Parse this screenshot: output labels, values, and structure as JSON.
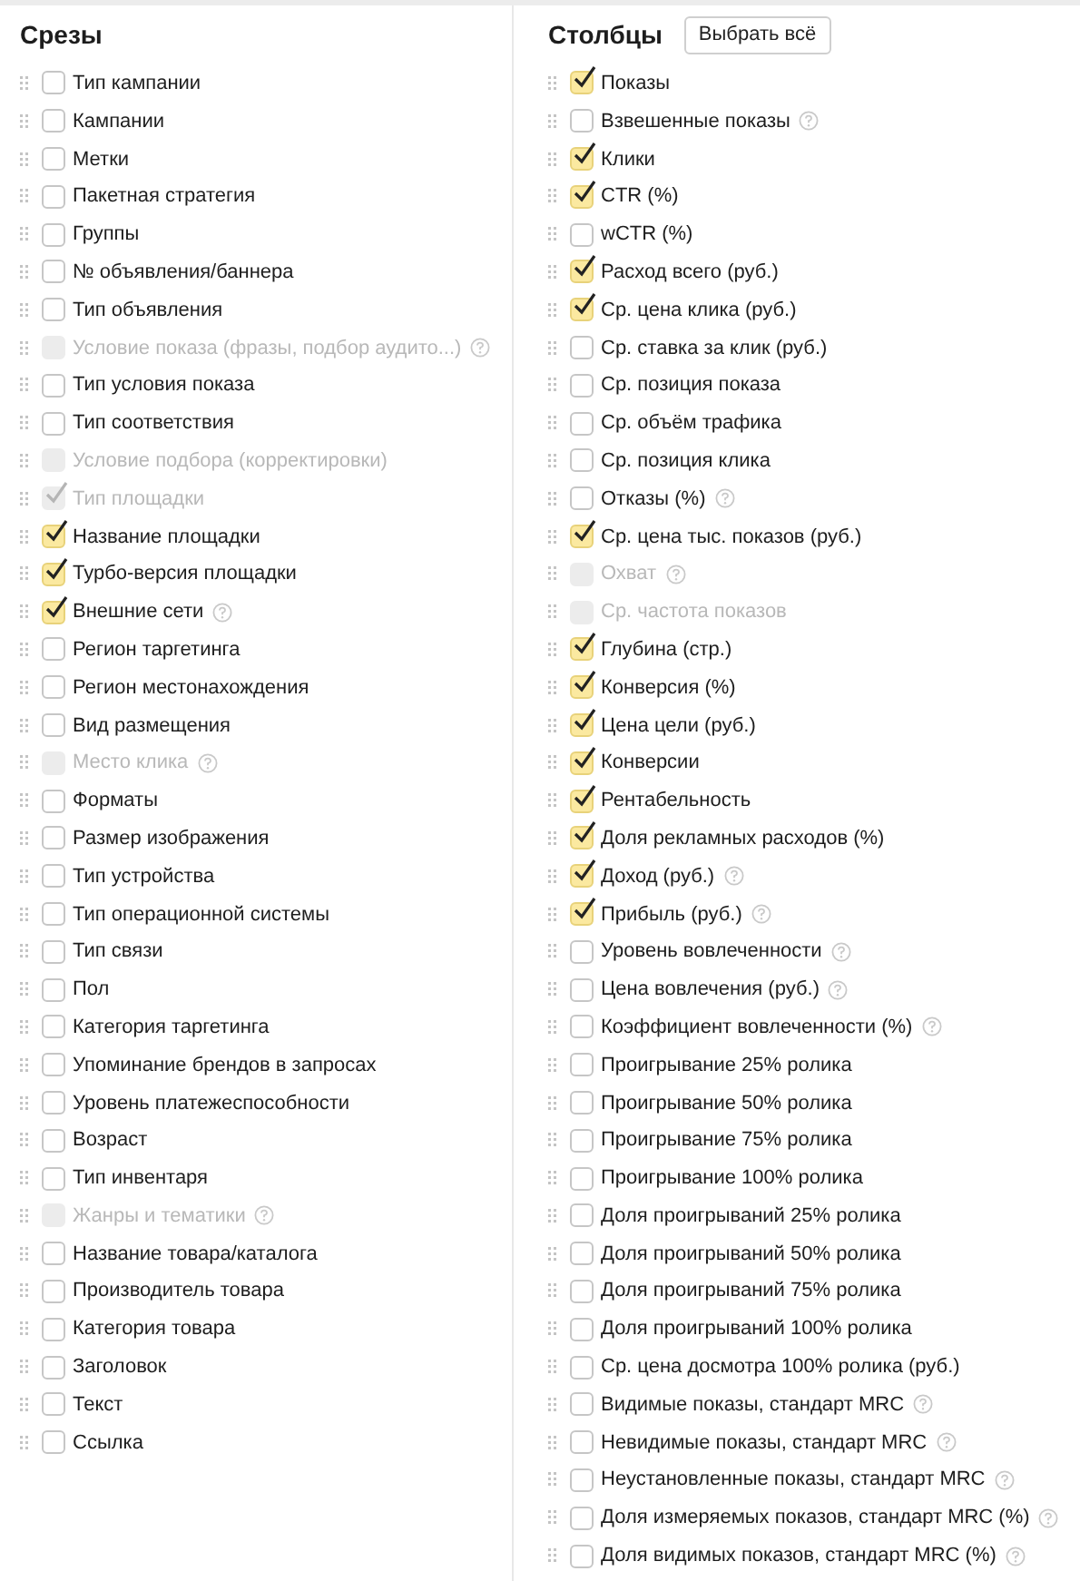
{
  "slices": {
    "title": "Срезы",
    "items": [
      {
        "label": "Тип кампании",
        "checked": false,
        "disabled": false,
        "help": false
      },
      {
        "label": "Кампании",
        "checked": false,
        "disabled": false,
        "help": false
      },
      {
        "label": "Метки",
        "checked": false,
        "disabled": false,
        "help": false
      },
      {
        "label": "Пакетная стратегия",
        "checked": false,
        "disabled": false,
        "help": false
      },
      {
        "label": "Группы",
        "checked": false,
        "disabled": false,
        "help": false
      },
      {
        "label": "№ объявления/баннера",
        "checked": false,
        "disabled": false,
        "help": false
      },
      {
        "label": "Тип объявления",
        "checked": false,
        "disabled": false,
        "help": false
      },
      {
        "label": "Условие показа (фразы, подбор аудито...)",
        "checked": false,
        "disabled": true,
        "help": true
      },
      {
        "label": "Тип условия показа",
        "checked": false,
        "disabled": false,
        "help": false
      },
      {
        "label": "Тип соответствия",
        "checked": false,
        "disabled": false,
        "help": false
      },
      {
        "label": "Условие подбора (корректировки)",
        "checked": false,
        "disabled": true,
        "help": false
      },
      {
        "label": "Тип площадки",
        "checked": true,
        "disabled": true,
        "help": false
      },
      {
        "label": "Название площадки",
        "checked": true,
        "disabled": false,
        "help": false
      },
      {
        "label": "Турбо-версия площадки",
        "checked": true,
        "disabled": false,
        "help": false
      },
      {
        "label": "Внешние сети",
        "checked": true,
        "disabled": false,
        "help": true
      },
      {
        "label": "Регион таргетинга",
        "checked": false,
        "disabled": false,
        "help": false
      },
      {
        "label": "Регион местонахождения",
        "checked": false,
        "disabled": false,
        "help": false
      },
      {
        "label": "Вид размещения",
        "checked": false,
        "disabled": false,
        "help": false
      },
      {
        "label": "Место клика",
        "checked": false,
        "disabled": true,
        "help": true
      },
      {
        "label": "Форматы",
        "checked": false,
        "disabled": false,
        "help": false
      },
      {
        "label": "Размер изображения",
        "checked": false,
        "disabled": false,
        "help": false
      },
      {
        "label": "Тип устройства",
        "checked": false,
        "disabled": false,
        "help": false
      },
      {
        "label": "Тип операционной системы",
        "checked": false,
        "disabled": false,
        "help": false
      },
      {
        "label": "Тип связи",
        "checked": false,
        "disabled": false,
        "help": false
      },
      {
        "label": "Пол",
        "checked": false,
        "disabled": false,
        "help": false
      },
      {
        "label": "Категория таргетинга",
        "checked": false,
        "disabled": false,
        "help": false
      },
      {
        "label": "Упоминание брендов в запросах",
        "checked": false,
        "disabled": false,
        "help": false
      },
      {
        "label": "Уровень платежеспособности",
        "checked": false,
        "disabled": false,
        "help": false
      },
      {
        "label": "Возраст",
        "checked": false,
        "disabled": false,
        "help": false
      },
      {
        "label": "Тип инвентаря",
        "checked": false,
        "disabled": false,
        "help": false
      },
      {
        "label": "Жанры и тематики",
        "checked": false,
        "disabled": true,
        "help": true
      },
      {
        "label": "Название товара/каталога",
        "checked": false,
        "disabled": false,
        "help": false
      },
      {
        "label": "Производитель товара",
        "checked": false,
        "disabled": false,
        "help": false
      },
      {
        "label": "Категория товара",
        "checked": false,
        "disabled": false,
        "help": false
      },
      {
        "label": "Заголовок",
        "checked": false,
        "disabled": false,
        "help": false
      },
      {
        "label": "Текст",
        "checked": false,
        "disabled": false,
        "help": false
      },
      {
        "label": "Ссылка",
        "checked": false,
        "disabled": false,
        "help": false
      }
    ]
  },
  "columns": {
    "title": "Столбцы",
    "select_all_button": "Выбрать всё",
    "items": [
      {
        "label": "Показы",
        "checked": true,
        "disabled": false,
        "help": false
      },
      {
        "label": "Взвешенные показы",
        "checked": false,
        "disabled": false,
        "help": true
      },
      {
        "label": "Клики",
        "checked": true,
        "disabled": false,
        "help": false
      },
      {
        "label": "CTR (%)",
        "checked": true,
        "disabled": false,
        "help": false
      },
      {
        "label": "wCTR (%)",
        "checked": false,
        "disabled": false,
        "help": false
      },
      {
        "label": "Расход всего (руб.)",
        "checked": true,
        "disabled": false,
        "help": false
      },
      {
        "label": "Ср. цена клика (руб.)",
        "checked": true,
        "disabled": false,
        "help": false
      },
      {
        "label": "Ср. ставка за клик (руб.)",
        "checked": false,
        "disabled": false,
        "help": false
      },
      {
        "label": "Ср. позиция показа",
        "checked": false,
        "disabled": false,
        "help": false
      },
      {
        "label": "Ср. объём трафика",
        "checked": false,
        "disabled": false,
        "help": false
      },
      {
        "label": "Ср. позиция клика",
        "checked": false,
        "disabled": false,
        "help": false
      },
      {
        "label": "Отказы (%)",
        "checked": false,
        "disabled": false,
        "help": true
      },
      {
        "label": "Ср. цена тыс. показов (руб.)",
        "checked": true,
        "disabled": false,
        "help": false
      },
      {
        "label": "Охват",
        "checked": false,
        "disabled": true,
        "help": true
      },
      {
        "label": "Ср. частота показов",
        "checked": false,
        "disabled": true,
        "help": false
      },
      {
        "label": "Глубина (стр.)",
        "checked": true,
        "disabled": false,
        "help": false
      },
      {
        "label": "Конверсия (%)",
        "checked": true,
        "disabled": false,
        "help": false
      },
      {
        "label": "Цена цели (руб.)",
        "checked": true,
        "disabled": false,
        "help": false
      },
      {
        "label": "Конверсии",
        "checked": true,
        "disabled": false,
        "help": false
      },
      {
        "label": "Рентабельность",
        "checked": true,
        "disabled": false,
        "help": false
      },
      {
        "label": "Доля рекламных расходов (%)",
        "checked": true,
        "disabled": false,
        "help": false
      },
      {
        "label": "Доход (руб.)",
        "checked": true,
        "disabled": false,
        "help": true
      },
      {
        "label": "Прибыль (руб.)",
        "checked": true,
        "disabled": false,
        "help": true
      },
      {
        "label": "Уровень вовлеченности",
        "checked": false,
        "disabled": false,
        "help": true
      },
      {
        "label": "Цена вовлечения (руб.)",
        "checked": false,
        "disabled": false,
        "help": true
      },
      {
        "label": "Коэффициент вовлеченности (%)",
        "checked": false,
        "disabled": false,
        "help": true
      },
      {
        "label": "Проигрывание 25% ролика",
        "checked": false,
        "disabled": false,
        "help": false
      },
      {
        "label": "Проигрывание 50% ролика",
        "checked": false,
        "disabled": false,
        "help": false
      },
      {
        "label": "Проигрывание 75% ролика",
        "checked": false,
        "disabled": false,
        "help": false
      },
      {
        "label": "Проигрывание 100% ролика",
        "checked": false,
        "disabled": false,
        "help": false
      },
      {
        "label": "Доля проигрываний 25% ролика",
        "checked": false,
        "disabled": false,
        "help": false
      },
      {
        "label": "Доля проигрываний 50% ролика",
        "checked": false,
        "disabled": false,
        "help": false
      },
      {
        "label": "Доля проигрываний 75% ролика",
        "checked": false,
        "disabled": false,
        "help": false
      },
      {
        "label": "Доля проигрываний 100% ролика",
        "checked": false,
        "disabled": false,
        "help": false
      },
      {
        "label": "Ср. цена досмотра 100% ролика (руб.)",
        "checked": false,
        "disabled": false,
        "help": false
      },
      {
        "label": "Видимые показы, стандарт MRC",
        "checked": false,
        "disabled": false,
        "help": true
      },
      {
        "label": "Невидимые показы, стандарт MRC",
        "checked": false,
        "disabled": false,
        "help": true
      },
      {
        "label": "Неустановленные показы, стандарт MRC",
        "checked": false,
        "disabled": false,
        "help": true
      },
      {
        "label": "Доля измеряемых показов, стандарт MRC (%)",
        "checked": false,
        "disabled": false,
        "help": true
      },
      {
        "label": "Доля видимых показов, стандарт MRC (%)",
        "checked": false,
        "disabled": false,
        "help": true
      }
    ]
  }
}
